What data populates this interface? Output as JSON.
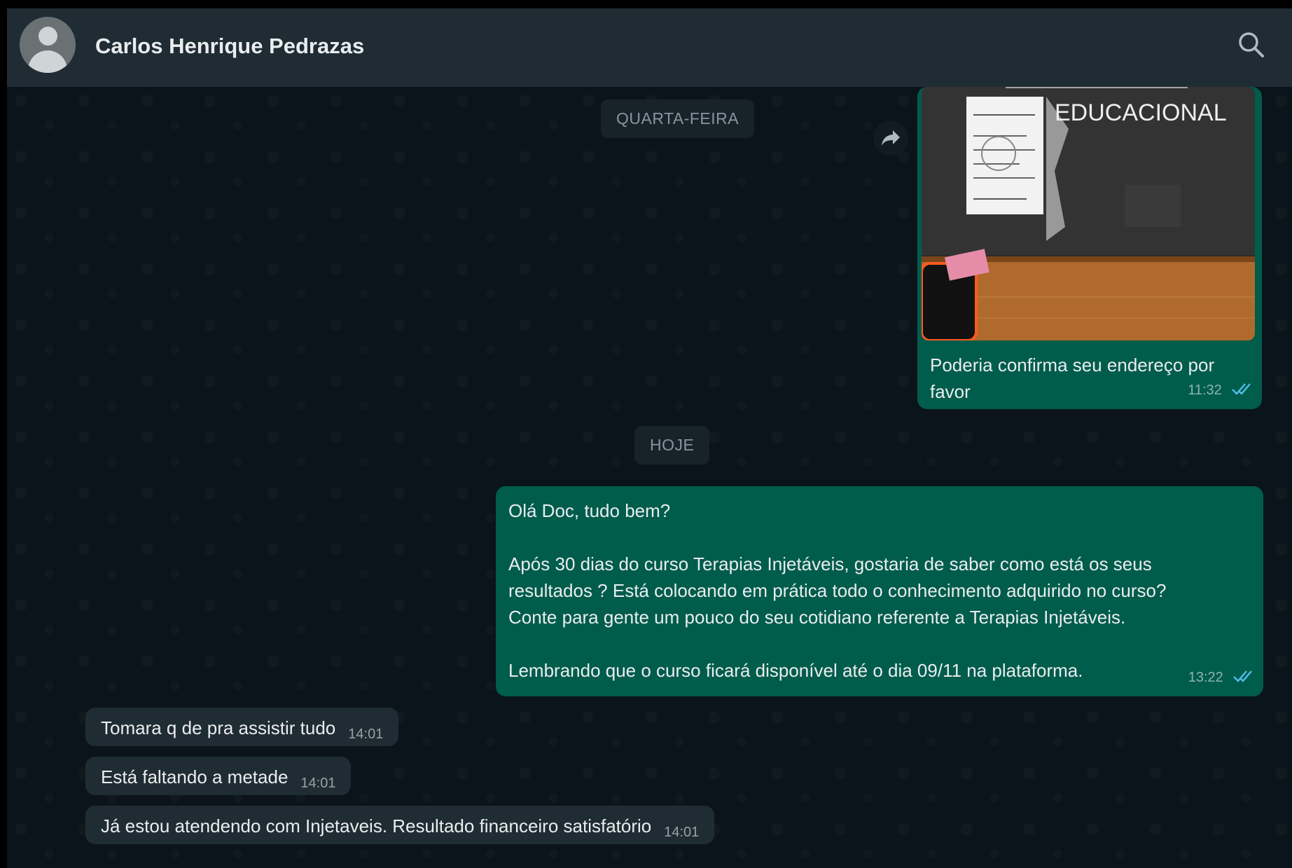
{
  "header": {
    "contact_name": "Carlos Henrique Pedrazas",
    "search_icon": "search-icon",
    "avatar_icon": "default-avatar-icon"
  },
  "messages": {
    "date_wednesday": "QUARTA-FEIRA",
    "date_today": "HOJE",
    "image_message": {
      "image_text": "EDUCACIONAL",
      "caption": "Poderia confirma seu endereço por favor",
      "time": "11:32",
      "status_icon": "double-check-icon"
    },
    "long_message": {
      "line1": "Olá Doc, tudo bem?",
      "line2": "Após 30 dias do curso Terapias Injetáveis, gostaria de saber como está os seus",
      "line3": "resultados ? Está colocando em prática todo o conhecimento adquirido no curso?",
      "line4": "Conte para gente um pouco do seu cotidiano referente a Terapias Injetáveis.",
      "line5": "Lembrando que o curso ficará disponível até o dia 09/11 na plataforma.",
      "time": "13:22",
      "status_icon": "double-check-icon"
    },
    "incoming": [
      {
        "text": "Tomara q de pra assistir tudo",
        "time": "14:01"
      },
      {
        "text": "Está faltando a metade",
        "time": "14:01"
      },
      {
        "text": "Já estou atendendo com Injetaveis. Resultado financeiro satisfatório",
        "time": "14:01"
      }
    ]
  },
  "colors": {
    "outgoing_bubble": "#005c4b",
    "incoming_bubble": "#202c33",
    "header_bg": "#202c33",
    "chat_bg": "#0b141a",
    "read_tick": "#53bdeb"
  }
}
